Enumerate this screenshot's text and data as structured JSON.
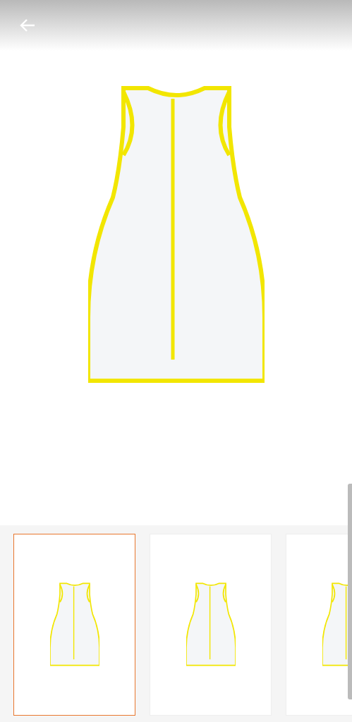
{
  "thumbnails": [
    {
      "selected": true
    },
    {
      "selected": false
    },
    {
      "selected": false
    }
  ]
}
